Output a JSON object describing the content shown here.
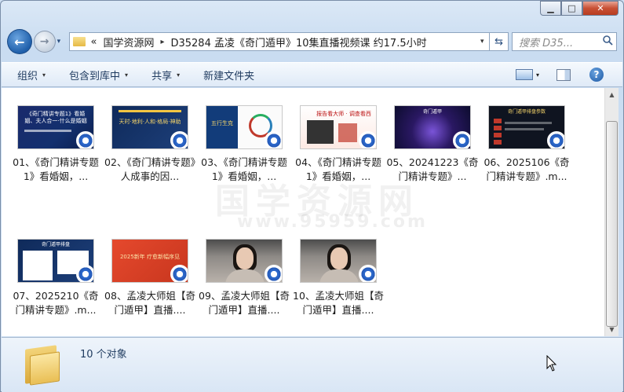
{
  "window": {
    "min_label": "▁",
    "max_label": "□",
    "close_label": "✕"
  },
  "nav": {
    "back_label": "←",
    "forward_label": "→",
    "history_label": "▾",
    "crumb_overflow": "«",
    "crumbs": [
      "国学资源网",
      "D35284 孟凌《奇门遁甲》10集直播视频课 约17.5小时"
    ],
    "crumb_sep": "▸",
    "dropdown_label": "▾",
    "refresh_label": "⇆",
    "search_placeholder": "搜索 D35...",
    "search_icon": "search-icon"
  },
  "toolbar": {
    "organize": "组织",
    "include_library": "包含到库中",
    "share": "共享",
    "new_folder": "新建文件夹",
    "arrow": "▾",
    "help": "?"
  },
  "watermark": {
    "text": "国学资源网",
    "url": "www.95959.com"
  },
  "files": [
    {
      "name": "01、《奇门精讲专题1》看婚姻，...",
      "thumb_text": "《奇门精讲专题1》看婚姻、夫人合一·什么是婚姻"
    },
    {
      "name": "02、《奇门精讲专题》人成事的因...",
      "thumb_text": "天时·地利·人和·格局·神助"
    },
    {
      "name": "03、《奇门精讲专题1》看婚姻，...",
      "thumb_text": "五行生克"
    },
    {
      "name": "04、《奇门精讲专题1》看婚姻，...",
      "thumb_text": "报告看大师 · 调查看西"
    },
    {
      "name": "05、20241223《奇门精讲专题》...",
      "thumb_text": "奇门遁甲"
    },
    {
      "name": "06、2025106《奇门精讲专题》.m...",
      "thumb_text": "奇门遁甲排盘参数"
    },
    {
      "name": "07、2025210《奇门精讲专题》.m...",
      "thumb_text": "奇门遁甲排盘"
    },
    {
      "name": "08、孟凌大师姐【奇门遁甲】直播....",
      "thumb_text": "2025新年 疗愈新幅序见"
    },
    {
      "name": "09、孟凌大师姐【奇门遁甲】直播....",
      "thumb_text": ""
    },
    {
      "name": "10、孟凌大师姐【奇门遁甲】直播....",
      "thumb_text": ""
    }
  ],
  "status": {
    "count_text": "10 个对象"
  },
  "colors": {
    "accent": "#1f5faa",
    "window_bg": "#cfe0f3",
    "close_red": "#c85035"
  }
}
